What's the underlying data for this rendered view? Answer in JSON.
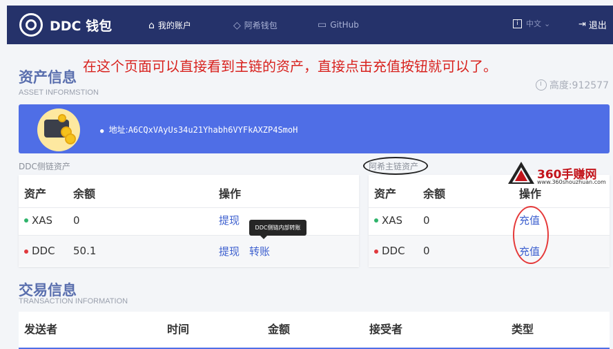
{
  "nav": {
    "brand": "DDC 钱包",
    "items": [
      {
        "label": "我的账户",
        "icon": "home-icon"
      },
      {
        "label": "阿希钱包",
        "icon": "diamond-icon"
      },
      {
        "label": "GitHub",
        "icon": "briefcase-icon"
      }
    ],
    "language": "中文",
    "logout": "退出"
  },
  "annotation": "在这个页面可以直接看到主链的资产，直接点击充值按钮就可以了。",
  "asset_section": {
    "title": "资产信息",
    "subtitle": "ASSET INFORMSTION",
    "height_label": "高度:912577"
  },
  "address": {
    "label": "地址:",
    "value": "A6CQxVAyUs34u21Yhabh6VYFkAXZP4SmoH"
  },
  "side_chain": {
    "caption": "DDC侧链资产",
    "headers": [
      "资产",
      "余额",
      "操作"
    ],
    "rows": [
      {
        "asset": "XAS",
        "balance": "0",
        "action1": "提现",
        "action2": ""
      },
      {
        "asset": "DDC",
        "balance": "50.1",
        "action1": "提现",
        "action2": "转账"
      }
    ],
    "tooltip": "DDC侧链内部转账"
  },
  "main_chain": {
    "caption": "阿希主链资产",
    "headers": [
      "资产",
      "余额",
      "操作"
    ],
    "rows": [
      {
        "asset": "XAS",
        "balance": "0",
        "action": "充值"
      },
      {
        "asset": "DDC",
        "balance": "0",
        "action": "充值"
      }
    ]
  },
  "watermark": {
    "title": "360手赚网",
    "url": "www.360shouzhuan.com"
  },
  "tx_section": {
    "title": "交易信息",
    "subtitle": "TRANSACTION INFORMATION",
    "headers": [
      "发送者",
      "时间",
      "金额",
      "接受者",
      "类型"
    ]
  },
  "colors": {
    "nav_bg": "#25326a",
    "banner": "#4f6ee6",
    "link": "#3c5fcf",
    "xas_dot": "#2fb36b",
    "ddc_dot": "#e0393e",
    "annotation": "#d8221e"
  }
}
